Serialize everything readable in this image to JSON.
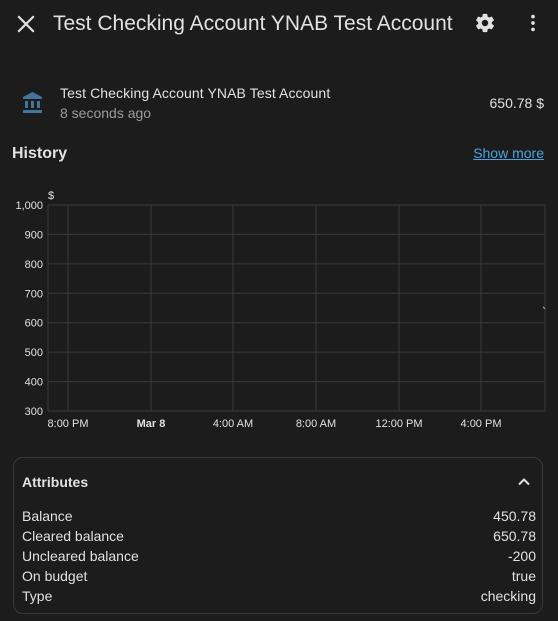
{
  "dialog": {
    "title": "Test Checking Account YNAB Test Account"
  },
  "entity": {
    "name": "Test Checking Account YNAB Test Account",
    "last_changed": "8 seconds ago",
    "state": "650.78 $",
    "icon": "bank-icon"
  },
  "history": {
    "title": "History",
    "show_more_label": "Show more"
  },
  "colors": {
    "background": "#1c1c1c",
    "text": "#e1e1e1",
    "secondary_text": "#9b9b9b",
    "link": "#4aa3e0",
    "accent_icon": "#44739e",
    "grid": "#3a3a3a"
  },
  "chart_data": {
    "type": "line",
    "ylabel": "$",
    "ylim": [
      300,
      1000
    ],
    "y_ticks": [
      "1,000",
      "900",
      "800",
      "700",
      "600",
      "500",
      "400",
      "300"
    ],
    "x_ticks": [
      "8:00 PM",
      "Mar 8",
      "4:00 AM",
      "8:00 AM",
      "12:00 PM",
      "4:00 PM"
    ],
    "x_ticks_bold": [
      false,
      true,
      false,
      false,
      false,
      false
    ],
    "grid": true,
    "series": [
      {
        "values": [
          650.78
        ]
      }
    ]
  },
  "attributes": {
    "title": "Attributes",
    "rows": [
      {
        "key": "Balance",
        "value": "450.78"
      },
      {
        "key": "Cleared balance",
        "value": "650.78"
      },
      {
        "key": "Uncleared balance",
        "value": "-200"
      },
      {
        "key": "On budget",
        "value": "true"
      },
      {
        "key": "Type",
        "value": "checking"
      }
    ]
  }
}
